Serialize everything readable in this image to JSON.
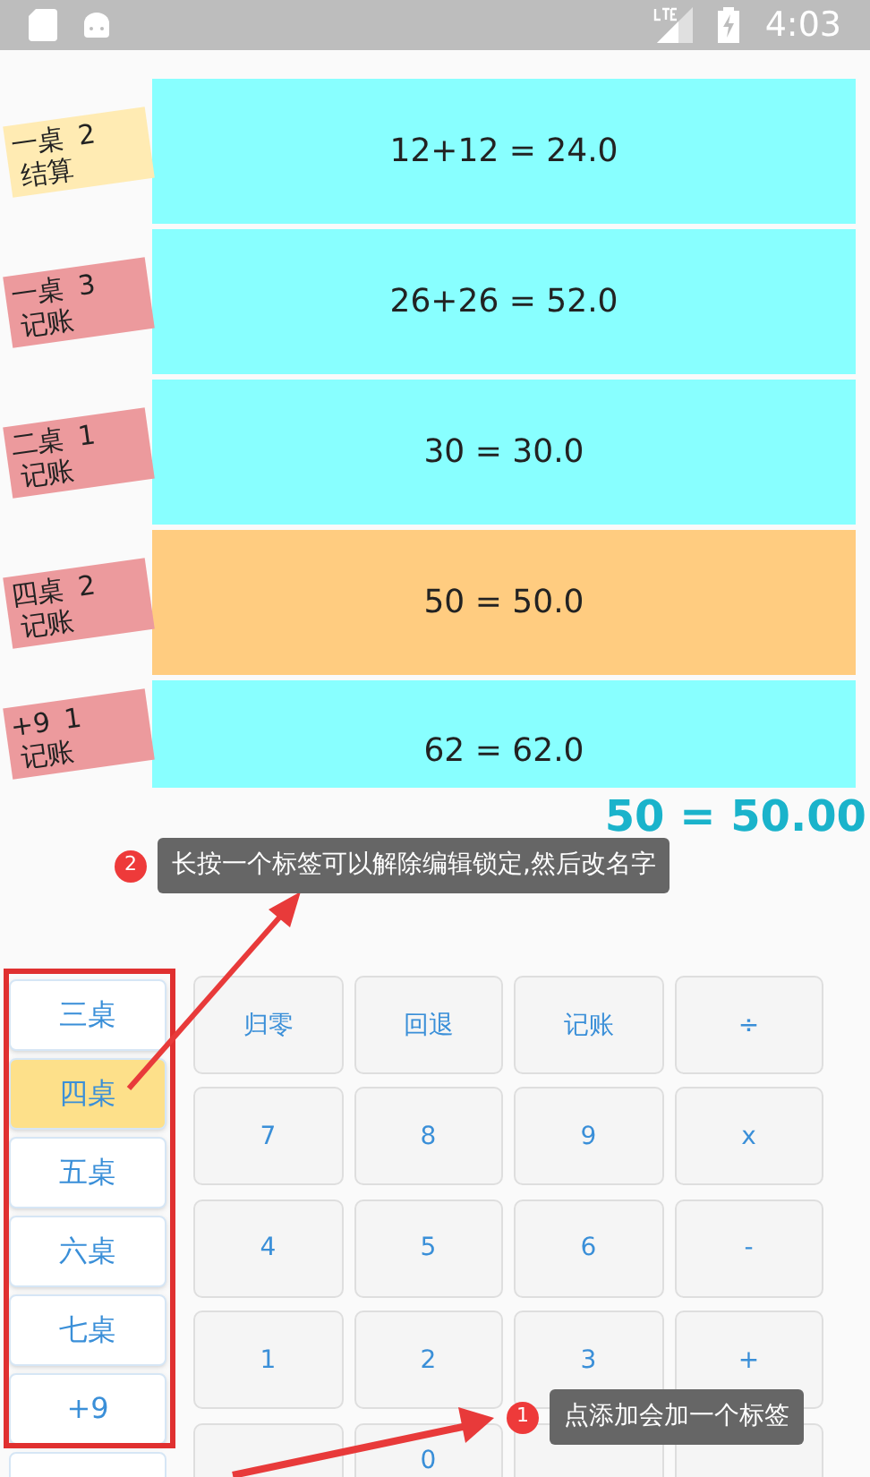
{
  "status_bar": {
    "time": "4:03"
  },
  "records": [
    {
      "table": "一桌",
      "count": "2",
      "action": "结算",
      "kind": "settle",
      "expression": "12+12 = 24.0",
      "selected": false
    },
    {
      "table": "一桌",
      "count": "3",
      "action": "记账",
      "kind": "record",
      "expression": "26+26 = 52.0",
      "selected": false
    },
    {
      "table": "二桌",
      "count": "1",
      "action": "记账",
      "kind": "record",
      "expression": "30 = 30.0",
      "selected": false
    },
    {
      "table": "四桌",
      "count": "2",
      "action": "记账",
      "kind": "record",
      "expression": "50 = 50.0",
      "selected": true
    },
    {
      "table": "+9",
      "count": "1",
      "action": "记账",
      "kind": "record",
      "expression": "62 = 62.0",
      "selected": false
    }
  ],
  "result": "50 = 50.00",
  "tips": [
    {
      "number": "2",
      "text": "长按一个标签可以解除编辑锁定,然后改名字"
    },
    {
      "number": "1",
      "text": "点添加会加一个标签"
    }
  ],
  "tables": [
    {
      "label": "三桌",
      "selected": false
    },
    {
      "label": "四桌",
      "selected": true
    },
    {
      "label": "五桌",
      "selected": false
    },
    {
      "label": "六桌",
      "selected": false
    },
    {
      "label": "七桌",
      "selected": false
    },
    {
      "label": "+9",
      "selected": false
    }
  ],
  "keypad": [
    [
      "归零",
      "回退",
      "记账",
      "÷"
    ],
    [
      "7",
      "8",
      "9",
      "x"
    ],
    [
      "4",
      "5",
      "6",
      "-"
    ],
    [
      "1",
      "2",
      "3",
      "+"
    ],
    [
      {
        "kind": "cut"
      },
      {
        "kind": "key",
        "label": "0"
      },
      {
        "kind": "cut"
      },
      {
        "kind": "cut"
      }
    ]
  ]
}
